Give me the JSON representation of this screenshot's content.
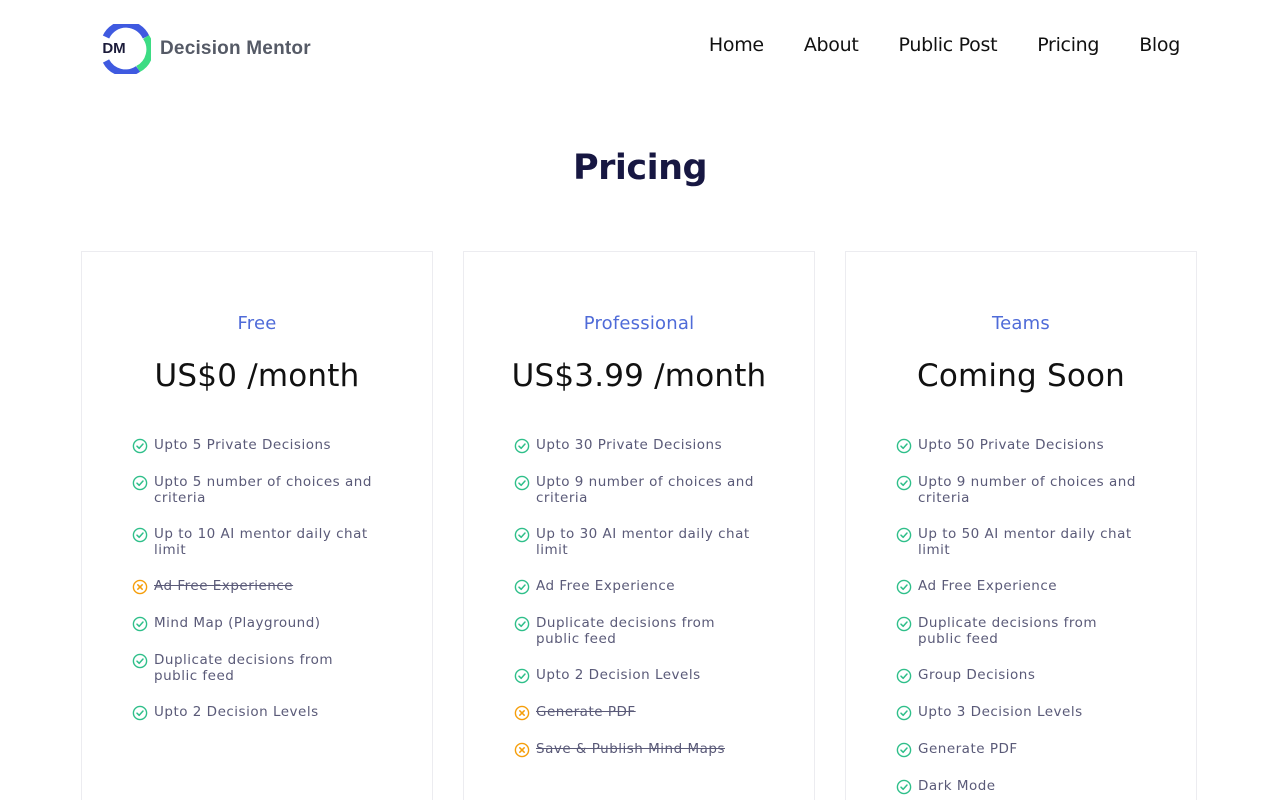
{
  "brand": {
    "logo_text": "DM",
    "name": "Decision Mentor"
  },
  "nav": [
    "Home",
    "About",
    "Public Post",
    "Pricing",
    "Blog"
  ],
  "page_title": "Pricing",
  "colors": {
    "check": "#2fbf8a",
    "cross": "#f59e0b",
    "accent": "#4f6bd8",
    "logo_blue": "#3f5ae0",
    "logo_green": "#3ddc84"
  },
  "plans": [
    {
      "name": "Free",
      "price": "US$0 /month",
      "features": [
        {
          "text": "Upto 5 Private Decisions",
          "included": true
        },
        {
          "text": "Upto 5 number of choices and criteria",
          "included": true
        },
        {
          "text": "Up to 10 AI mentor daily chat limit",
          "included": true
        },
        {
          "text": "Ad Free Experience",
          "included": false
        },
        {
          "text": "Mind Map (Playground)",
          "included": true
        },
        {
          "text": "Duplicate decisions from public feed",
          "included": true
        },
        {
          "text": "Upto 2 Decision Levels",
          "included": true
        }
      ]
    },
    {
      "name": "Professional",
      "price": "US$3.99 /month",
      "features": [
        {
          "text": "Upto 30 Private Decisions",
          "included": true
        },
        {
          "text": "Upto 9 number of choices and criteria",
          "included": true
        },
        {
          "text": "Up to 30 AI mentor daily chat limit",
          "included": true
        },
        {
          "text": "Ad Free Experience",
          "included": true
        },
        {
          "text": "Duplicate decisions from public feed",
          "included": true
        },
        {
          "text": "Upto 2 Decision Levels",
          "included": true
        },
        {
          "text": "Generate PDF",
          "included": false
        },
        {
          "text": "Save & Publish Mind Maps",
          "included": false
        }
      ]
    },
    {
      "name": "Teams",
      "price": "Coming Soon",
      "features": [
        {
          "text": "Upto 50 Private Decisions",
          "included": true
        },
        {
          "text": "Upto 9 number of choices and criteria",
          "included": true
        },
        {
          "text": "Up to 50 AI mentor daily chat limit",
          "included": true
        },
        {
          "text": "Ad Free Experience",
          "included": true
        },
        {
          "text": "Duplicate decisions from public feed",
          "included": true
        },
        {
          "text": "Group Decisions",
          "included": true
        },
        {
          "text": "Upto 3 Decision Levels",
          "included": true
        },
        {
          "text": "Generate PDF",
          "included": true
        },
        {
          "text": "Dark Mode",
          "included": true
        }
      ]
    }
  ]
}
